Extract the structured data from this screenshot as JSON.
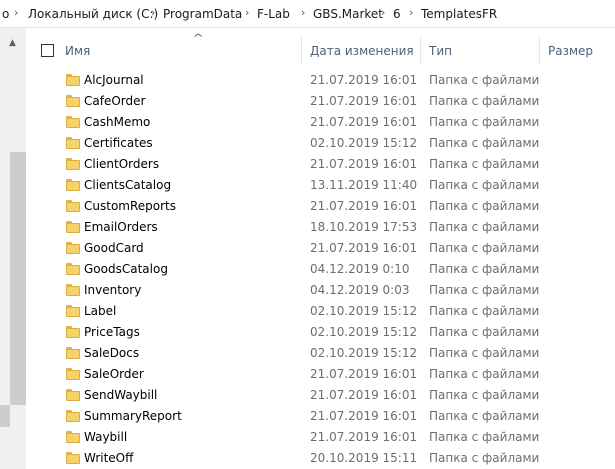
{
  "breadcrumb": {
    "items": [
      "o",
      "Локальный диск (C:)",
      "ProgramData",
      "F-Lab",
      "GBS.Market",
      "6",
      "TemplatesFR"
    ]
  },
  "columns": {
    "name": "Имя",
    "date": "Дата изменения",
    "type": "Тип",
    "size": "Размер"
  },
  "icons": {
    "folder": "folder-icon",
    "sort": "sort-up-icon",
    "separator": "chevron-right-icon"
  },
  "colors": {
    "header_text": "#4c607a",
    "secondary_text": "#6d6d6d",
    "folder": "#f5d36b"
  },
  "files": [
    {
      "name": "AlcJournal",
      "date": "21.07.2019 16:01",
      "type": "Папка с файлами"
    },
    {
      "name": "CafeOrder",
      "date": "21.07.2019 16:01",
      "type": "Папка с файлами"
    },
    {
      "name": "CashMemo",
      "date": "21.07.2019 16:01",
      "type": "Папка с файлами"
    },
    {
      "name": "Certificates",
      "date": "02.10.2019 15:12",
      "type": "Папка с файлами"
    },
    {
      "name": "ClientOrders",
      "date": "21.07.2019 16:01",
      "type": "Папка с файлами"
    },
    {
      "name": "ClientsCatalog",
      "date": "13.11.2019 11:40",
      "type": "Папка с файлами"
    },
    {
      "name": "CustomReports",
      "date": "21.07.2019 16:01",
      "type": "Папка с файлами"
    },
    {
      "name": "EmailOrders",
      "date": "18.10.2019 17:53",
      "type": "Папка с файлами"
    },
    {
      "name": "GoodCard",
      "date": "21.07.2019 16:01",
      "type": "Папка с файлами"
    },
    {
      "name": "GoodsCatalog",
      "date": "04.12.2019 0:10",
      "type": "Папка с файлами"
    },
    {
      "name": "Inventory",
      "date": "04.12.2019 0:03",
      "type": "Папка с файлами"
    },
    {
      "name": "Label",
      "date": "02.10.2019 15:12",
      "type": "Папка с файлами"
    },
    {
      "name": "PriceTags",
      "date": "02.10.2019 15:12",
      "type": "Папка с файлами"
    },
    {
      "name": "SaleDocs",
      "date": "02.10.2019 15:12",
      "type": "Папка с файлами"
    },
    {
      "name": "SaleOrder",
      "date": "21.07.2019 16:01",
      "type": "Папка с файлами"
    },
    {
      "name": "SendWaybill",
      "date": "21.07.2019 16:01",
      "type": "Папка с файлами"
    },
    {
      "name": "SummaryReport",
      "date": "21.07.2019 16:01",
      "type": "Папка с файлами"
    },
    {
      "name": "Waybill",
      "date": "21.07.2019 16:01",
      "type": "Папка с файлами"
    },
    {
      "name": "WriteOff",
      "date": "20.10.2019 15:11",
      "type": "Папка с файлами"
    }
  ]
}
